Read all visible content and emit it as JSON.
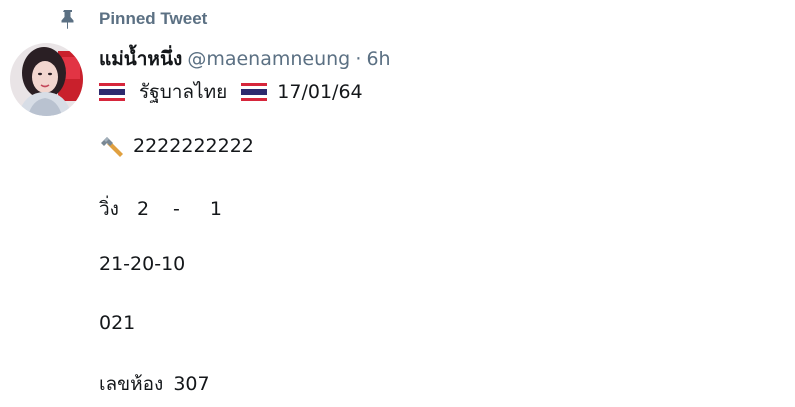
{
  "pinned": {
    "icon": "pin-icon",
    "label": "Pinned Tweet"
  },
  "tweet": {
    "author": {
      "display_name": "แม่น้ำหนึ่ง",
      "handle": "@maenamneung",
      "separator": "·",
      "time": "6h",
      "avatar": "avatar"
    },
    "flag_line": {
      "text": "รัฐบาลไทย",
      "date": "17/01/64",
      "flag_icon": "thai-flag-icon"
    },
    "hammer_line": {
      "icon": "hammer-icon",
      "text": "2222222222"
    },
    "run_line": {
      "label": "วิ่ง",
      "first": "2",
      "dash": "-",
      "second": "1"
    },
    "numbers_line": "21-20-10",
    "line_021": "021",
    "room_line": {
      "label": "เลขห้อง",
      "value": "307"
    }
  },
  "colors": {
    "text": "#14171a",
    "secondary": "#5b7083",
    "flag_red": "#d6263b",
    "flag_white": "#ffffff",
    "flag_blue": "#2d2a6e"
  }
}
